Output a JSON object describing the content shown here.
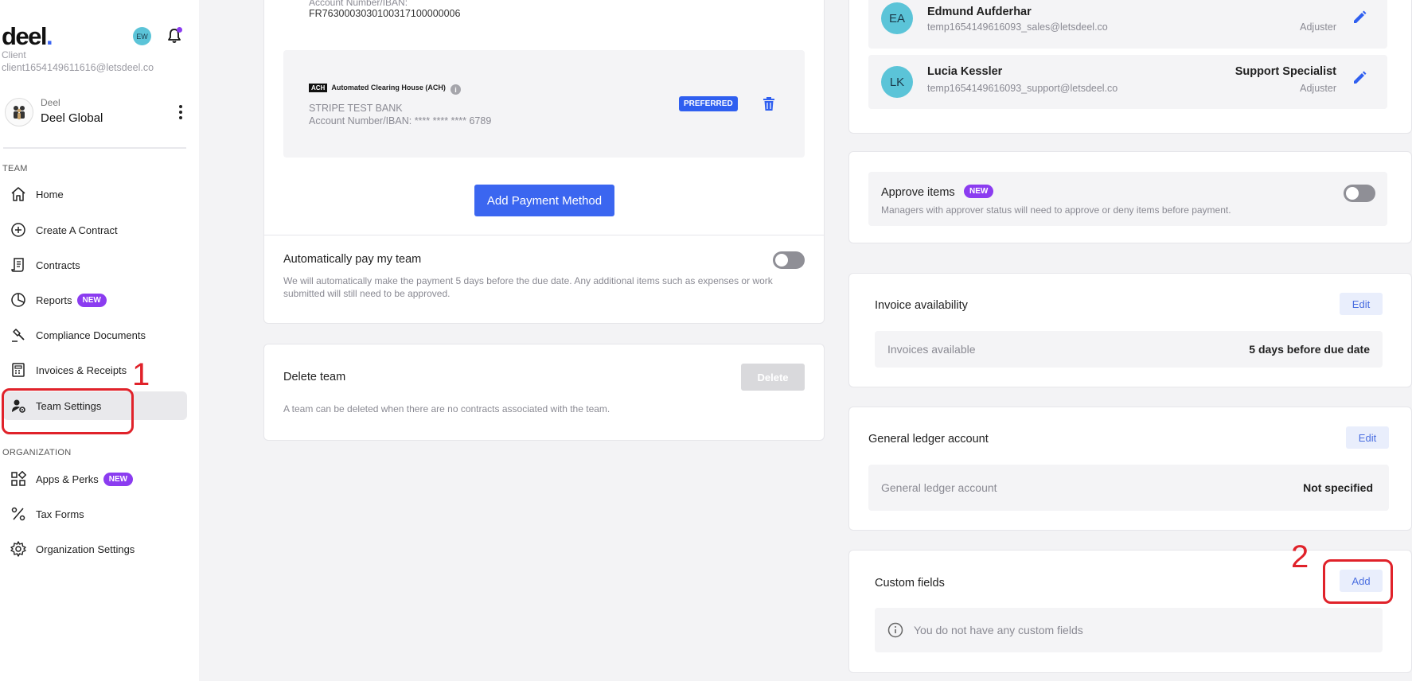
{
  "sidebar": {
    "logo": "deel",
    "logo_dot": ".",
    "user_initials": "EW",
    "client_role": "Client",
    "client_email": "client1654149611616@letsdeel.co",
    "org_small": "Deel",
    "org_name": "Deel Global",
    "team_label": "TEAM",
    "organization_label": "ORGANIZATION",
    "team_items": [
      {
        "label": "Home",
        "icon": "home-icon"
      },
      {
        "label": "Create A Contract",
        "icon": "plus-circle-icon"
      },
      {
        "label": "Contracts",
        "icon": "contract-scroll-icon"
      },
      {
        "label": "Reports",
        "icon": "pie-chart-icon",
        "badge": "NEW"
      },
      {
        "label": "Compliance Documents",
        "icon": "gavel-icon"
      },
      {
        "label": "Invoices & Receipts",
        "icon": "calculator-icon"
      },
      {
        "label": "Team Settings",
        "icon": "user-gear-icon"
      }
    ],
    "org_items": [
      {
        "label": "Apps & Perks",
        "icon": "apps-grid-icon",
        "badge": "NEW"
      },
      {
        "label": "Tax Forms",
        "icon": "percent-icon"
      },
      {
        "label": "Organization Settings",
        "icon": "gear-icon"
      }
    ]
  },
  "annotations": {
    "one": "1",
    "two": "2"
  },
  "payments": {
    "top_account_label": "Account Number/IBAN:",
    "top_account_number": "FR7630003030100317100000006",
    "ach_tag": "ACH",
    "ach_title": "Automated Clearing House (ACH)",
    "bank_name": "STRIPE TEST BANK",
    "account_line": "Account Number/IBAN: **** **** **** 6789",
    "preferred_badge": "PREFERRED",
    "add_button": "Add Payment Method",
    "autopay_title": "Automatically pay my team",
    "autopay_desc_1": "We will automatically make the payment 5 days before the due date. Any additional items such as expenses or work",
    "autopay_desc_2": "submitted will still need to be approved.",
    "autopay_enabled": false
  },
  "delete_team": {
    "title": "Delete team",
    "button": "Delete",
    "desc": "A team can be deleted when there are no contracts associated with the team."
  },
  "members": [
    {
      "initials": "EA",
      "name": "Edmund Aufderhar",
      "email": "temp1654149616093_sales@letsdeel.co",
      "title": "",
      "role": "Adjuster"
    },
    {
      "initials": "LK",
      "name": "Lucia Kessler",
      "email": "temp1654149616093_support@letsdeel.co",
      "title": "Support Specialist",
      "role": "Adjuster"
    }
  ],
  "approve": {
    "title": "Approve items",
    "badge": "NEW",
    "desc": "Managers with approver status will need to approve or deny items before payment.",
    "enabled": false
  },
  "invoice": {
    "title": "Invoice availability",
    "edit": "Edit",
    "row_label": "Invoices available",
    "row_value": "5 days before due date"
  },
  "ledger": {
    "title": "General ledger account",
    "edit": "Edit",
    "row_label": "General ledger account",
    "row_value": "Not specified"
  },
  "custom_fields": {
    "title": "Custom fields",
    "add": "Add",
    "empty": "You do not have any custom fields"
  }
}
